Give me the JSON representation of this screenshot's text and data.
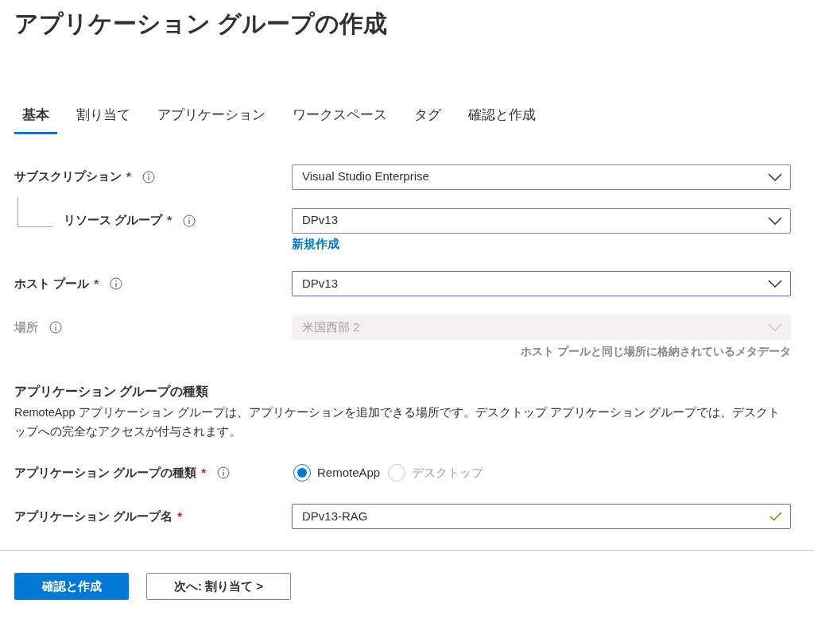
{
  "title": "アプリケーション グループの作成",
  "tabs": [
    {
      "label": "基本",
      "selected": true
    },
    {
      "label": "割り当て",
      "selected": false
    },
    {
      "label": "アプリケーション",
      "selected": false
    },
    {
      "label": "ワークスペース",
      "selected": false
    },
    {
      "label": "タグ",
      "selected": false
    },
    {
      "label": "確認と作成",
      "selected": false
    }
  ],
  "form_rows": [
    {
      "kind": "select",
      "label": "サブスクリプション",
      "required_mark": "*",
      "info": true,
      "value": "Visual Studio Enterprise",
      "nested": false,
      "disabled": false,
      "modified": false
    },
    {
      "kind": "select",
      "label": "リソース グループ",
      "required_mark": "*",
      "info": true,
      "value": "DPv13",
      "nested": true,
      "disabled": false,
      "modified": false,
      "link": "新規作成"
    },
    {
      "kind": "select",
      "label": "ホスト プール",
      "required_mark": "*",
      "info": true,
      "value": "DPv13",
      "nested": false,
      "disabled": false,
      "modified": true
    },
    {
      "kind": "select",
      "label": "場所",
      "info": true,
      "value": "米国西部 2",
      "nested": false,
      "disabled": true,
      "modified": false,
      "hint": "ホスト プールと同じ場所に格納されているメタデータ"
    }
  ],
  "section": {
    "title": "アプリケーション グループの種類",
    "description": "RemoteApp アプリケーション グループは、アプリケーションを追加できる場所です。デスクトップ アプリケーション グループでは、デスクトップへの完全なアクセスが付与されます。"
  },
  "section_rows": [
    {
      "kind": "radio",
      "label": "アプリケーション グループの種類",
      "required_mark": "*",
      "info": true,
      "options": [
        {
          "label": "RemoteApp",
          "selected": true,
          "disabled": false
        },
        {
          "label": "デスクトップ",
          "selected": false,
          "disabled": true
        }
      ]
    },
    {
      "kind": "text",
      "label": "アプリケーション グループ名",
      "required_mark": "*",
      "info": false,
      "value": "DPv13-RAG",
      "disabled": false,
      "modified": true,
      "valid": true
    }
  ],
  "buttons": [
    {
      "label": "確認と作成",
      "primary": true
    },
    {
      "label": "次へ: 割り当て >",
      "primary": false
    }
  ]
}
